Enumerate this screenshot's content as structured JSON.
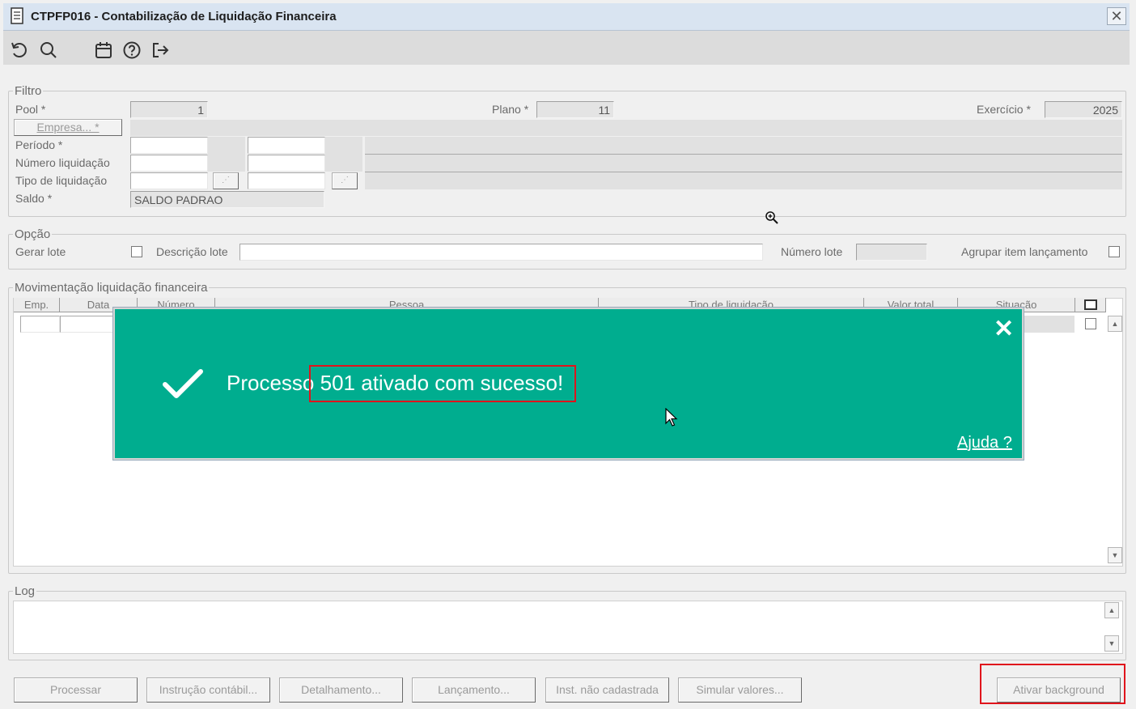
{
  "window": {
    "title": "CTPFP016 - Contabilização de Liquidação Financeira",
    "close_glyph": "✕"
  },
  "toolbar": {
    "icons": [
      "undo-icon",
      "search-icon",
      "calendar-icon",
      "help-icon",
      "exit-icon"
    ]
  },
  "filtro": {
    "label": "Filtro",
    "pool_label": "Pool *",
    "pool_value": "1",
    "plano_label": "Plano *",
    "plano_value": "11",
    "exercicio_label": "Exercício *",
    "exercicio_value": "2025",
    "empresa_button": "Empresa... *",
    "periodo_label": "Período *",
    "numero_liq_label": "Número liquidação",
    "tipo_liq_label": "Tipo de liquidação",
    "saldo_label": "Saldo *",
    "saldo_value": "SALDO PADRAO"
  },
  "opcao": {
    "label": "Opção",
    "gerar_lote_label": "Gerar lote",
    "descricao_lote_label": "Descrição lote",
    "numero_lote_label": "Número lote",
    "agrupar_label": "Agrupar item lançamento"
  },
  "movimentacao": {
    "label": "Movimentação liquidação financeira",
    "columns": [
      "Emp.",
      "Data",
      "Número",
      "Pessoa",
      "Tipo de liquidação",
      "Valor total",
      "Situação"
    ]
  },
  "log": {
    "label": "Log"
  },
  "buttons": {
    "processar": "Processar",
    "instrucao": "Instrução contábil...",
    "detalhamento": "Detalhamento...",
    "lancamento": "Lançamento...",
    "inst_nao_cad": "Inst. não cadastrada",
    "simular": "Simular valores...",
    "ativar": "Ativar background"
  },
  "modal": {
    "message_prefix": "Processo",
    "message_highlight": "501 ativado com sucesso!",
    "close_glyph": "✕",
    "help_link": "Ajuda ?",
    "background_color": "#00ad8f"
  }
}
